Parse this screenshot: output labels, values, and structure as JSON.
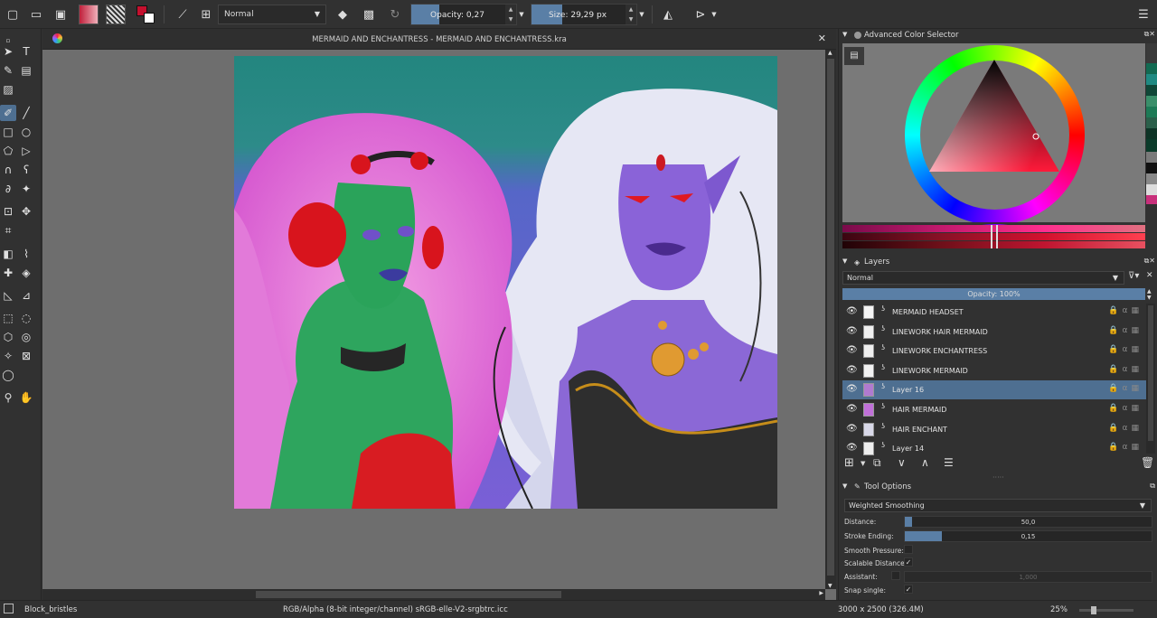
{
  "toolbar": {
    "blend_mode": "Normal",
    "opacity_label": "Opacity:",
    "opacity_value": "0,27",
    "opacity_fraction": 0.27,
    "size_label": "Size:",
    "size_value": "29,29 px",
    "size_fraction": 0.29
  },
  "document": {
    "title": "MERMAID AND ENCHANTRESS - MERMAID AND ENCHANTRESS.kra"
  },
  "color_selector": {
    "title": "Advanced Color Selector",
    "colors": {
      "hue": "#d3112e",
      "teal": "#1f8a82",
      "purple": "#7856cc"
    }
  },
  "layers": {
    "title": "Layers",
    "blend_mode": "Normal",
    "opacity_label": "Opacity:  100%",
    "items": [
      {
        "name": "MERMAID HEADSET",
        "selected": false
      },
      {
        "name": "LINEWORK HAIR MERMAID",
        "selected": false
      },
      {
        "name": "LINEWORK ENCHANTRESS",
        "selected": false
      },
      {
        "name": "LINEWORK MERMAID",
        "selected": false
      },
      {
        "name": "Layer 16",
        "selected": true
      },
      {
        "name": "HAIR MERMAID",
        "selected": false
      },
      {
        "name": "HAIR ENCHANT",
        "selected": false
      },
      {
        "name": "Layer 14",
        "selected": false
      }
    ]
  },
  "tool_options": {
    "title": "Tool Options",
    "smoothing": "Weighted Smoothing",
    "distance_label": "Distance:",
    "distance_value": "50,0",
    "distance_fraction": 0.03,
    "stroke_ending_label": "Stroke Ending:",
    "stroke_ending_value": "0,15",
    "stroke_ending_fraction": 0.15,
    "smooth_pressure_label": "Smooth Pressure:",
    "scalable_distance_label": "Scalable Distance:",
    "assistant_label": "Assistant:",
    "assistant_value": "1,000",
    "snap_single_label": "Snap single:"
  },
  "status": {
    "brush": "Block_bristles",
    "color_info": "RGB/Alpha (8-bit integer/channel)  sRGB-elle-V2-srgbtrc.icc",
    "image_size": "3000 x 2500 (326.4M)",
    "zoom": "25%"
  }
}
